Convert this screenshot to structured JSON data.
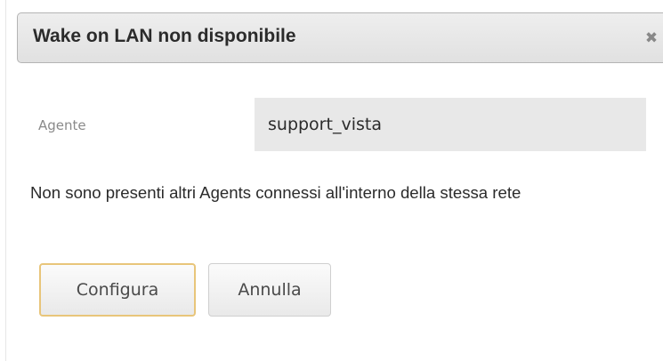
{
  "dialog": {
    "title": "Wake on LAN non disponibile",
    "close_icon": "close-icon",
    "close_glyph": "✖"
  },
  "form": {
    "agent_label": "Agente",
    "agent_value": "support_vista"
  },
  "message": "Non sono presenti altri Agents connessi all'interno della stessa rete",
  "buttons": {
    "configure_label": "Configura",
    "cancel_label": "Annulla"
  },
  "colors": {
    "primary_button_border": "#e8c57a",
    "titlebar_background": "#e5e5e5",
    "field_background": "#e8e8e8"
  }
}
